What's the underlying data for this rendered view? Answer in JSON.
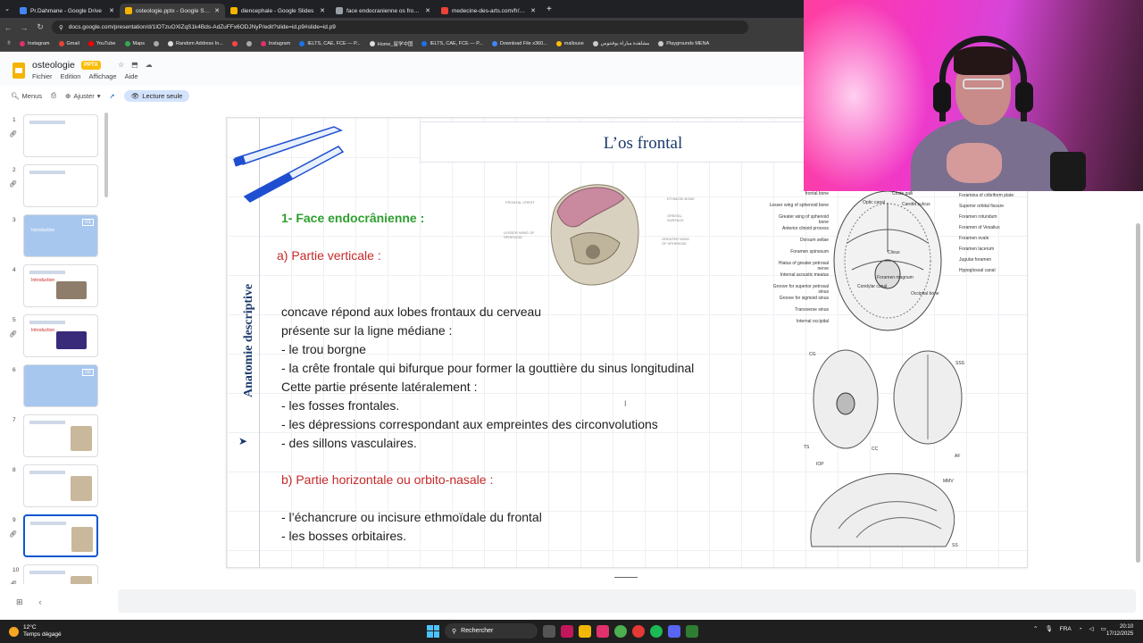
{
  "browser": {
    "tabs": [
      {
        "label": "Pr.Dahmane - Google Drive",
        "color": "#4285f4",
        "active": false
      },
      {
        "label": "osteologie.pptx - Google Slides",
        "color": "#f4b400",
        "active": true
      },
      {
        "label": "diencephale - Google Slides",
        "color": "#f4b400",
        "active": false
      },
      {
        "label": "face endocranienne os frontal",
        "color": "#9aa0a6",
        "active": false
      },
      {
        "label": "medecine-des-arts.com/fr/artic",
        "color": "#ea4335",
        "active": false
      }
    ],
    "url": "docs.google.com/presentation/d/1lOTzuOXlZqS1k4Bds-AdZuFFx6ODJNyP/edit?slide=id.p9#slide=id.p9",
    "bookmarks": [
      "Instagram",
      "Gmail",
      "YouTube",
      "Maps",
      "",
      "Random Address In...",
      "",
      "",
      "Instagram",
      "IELTS, CAE, FCE — P...",
      "Home_留学中国",
      "IELTS, CAE, FCE — P...",
      "Download File x360...",
      "mallouse",
      "مشاهدة مباراة يوفنتوس",
      "Playgrounds MENA"
    ]
  },
  "slides_app": {
    "title": "osteologie",
    "badge": "PPTX",
    "menus": [
      "Fichier",
      "Edition",
      "Affichage",
      "Aide"
    ],
    "toolbar": {
      "menus": "Menus",
      "zoom": "Ajuster",
      "readonly": "Lecture seule"
    }
  },
  "filmstrip": [
    {
      "num": "1",
      "link": true,
      "type": "white",
      "selected": false
    },
    {
      "num": "2",
      "link": true,
      "type": "white",
      "selected": false
    },
    {
      "num": "3",
      "link": false,
      "type": "blue",
      "selected": false,
      "text": "Introduction",
      "tag": "01"
    },
    {
      "num": "4",
      "link": false,
      "type": "white",
      "selected": false,
      "text": "Introduction"
    },
    {
      "num": "5",
      "link": true,
      "type": "white",
      "selected": false,
      "text": "Introduction"
    },
    {
      "num": "6",
      "link": false,
      "type": "blue",
      "selected": false,
      "tag": "02"
    },
    {
      "num": "7",
      "link": false,
      "type": "white",
      "selected": false
    },
    {
      "num": "8",
      "link": false,
      "type": "white",
      "selected": false
    },
    {
      "num": "9",
      "link": true,
      "type": "white",
      "selected": true
    },
    {
      "num": "10",
      "link": true,
      "type": "white",
      "selected": false
    }
  ],
  "slide": {
    "title": "L’os frontal",
    "side_label": "Anatomie descriptive",
    "heading1": "1- Face endocrânienne :",
    "sub_a": "a)  Partie verticale :",
    "body_lines": [
      " concave répond aux lobes frontaux du cerveau",
      "présente sur la ligne médiane :",
      "- le trou borgne",
      "- la crête frontale qui bifurque pour former la gouttière du sinus longitudinal",
      "Cette partie présente latéralement :",
      "- les fosses frontales.",
      "- les dépressions correspondant aux empreintes des circonvolutions",
      "- des sillons vasculaires."
    ],
    "sub_b": "b) Partie horizontale ou orbito-nasale :",
    "body_lines_b": [
      "- l’échancrure ou incisure ethmoïdale du frontal",
      "- les bosses orbitaires."
    ],
    "skull_labels": [
      "FRONTAL CREST",
      "LESSER WING OF SPHENOID",
      "ETHMOID BONE",
      "ORBITAL SURFACE",
      "GREATER WING OF SPHENOID"
    ],
    "plate_labels_left": [
      "frontal bone",
      "Lesser wing of sphenoid bone",
      "Greater wing of sphenoid bone",
      "Anterior clinoid process",
      "Dorsum sellae",
      "Foramen spinosum",
      "Hiatus of greater petrosal nerve",
      "Internal acoustic meatus",
      "Groove for superior petrosal sinus",
      "Groove for sigmoid sinus",
      "Transverse sinus",
      "Internal occipital"
    ],
    "plate_labels_right": [
      "Foramina of cribriform plate",
      "Superior orbital fissure",
      "Foramen rotundum",
      "Foramen of Vesalius",
      "Foramen ovale",
      "Foramen lacerum",
      "Jugular foramen",
      "Hypoglossal canal"
    ],
    "plate_labels_inner": [
      "Crista galli",
      "Optic canal",
      "Carotid sulcus",
      "Clivus",
      "Foramen magnum",
      "Occipital bone",
      "Condylar canal"
    ],
    "figure_letters": [
      "CG",
      "SSS",
      "TS",
      "CC",
      "IOP",
      "AF",
      "MMV",
      "SS"
    ]
  },
  "taskbar": {
    "temp": "12°C",
    "weather": "Temps dégagé",
    "search": "Rechercher",
    "lang": "FRA",
    "time": "20:10",
    "date": "17/12/2025"
  },
  "colors": {
    "accent_green": "#2e9e2e",
    "accent_red": "#c62828",
    "title_blue": "#1b3a6b",
    "selection": "#0b57d0"
  }
}
